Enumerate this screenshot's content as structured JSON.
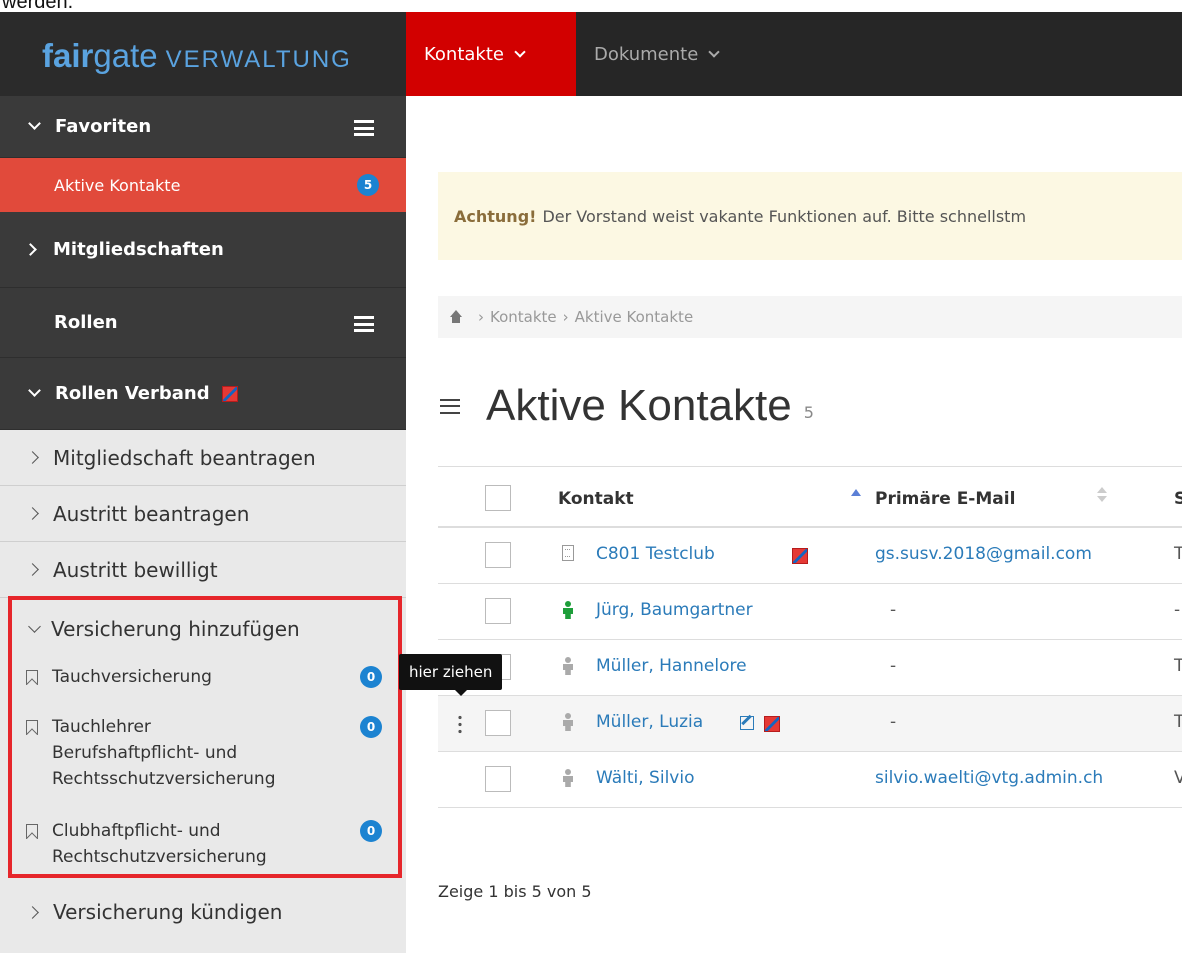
{
  "top_fragment": "werden.",
  "brand": {
    "fair": "fair",
    "gate": "gate",
    "suffix": "VERWALTUNG"
  },
  "nav": {
    "kontakte": "Kontakte",
    "dokumente": "Dokumente"
  },
  "sidebar": {
    "favoriten": "Favoriten",
    "aktive_kontakte": "Aktive Kontakte",
    "aktive_count": "5",
    "mitgliedschaften": "Mitgliedschaften",
    "rollen": "Rollen",
    "rollen_verband": "Rollen Verband",
    "items": [
      "Mitgliedschaft beantragen",
      "Austritt beantragen",
      "Austritt bewilligt"
    ],
    "versicherung_group": "Versicherung hinzufügen",
    "versicherung_items": [
      {
        "line1": "Tauchversicherung",
        "line2": "",
        "line3": "",
        "count": "0"
      },
      {
        "line1": "Tauchlehrer",
        "line2": "Berufshaftpflicht- und",
        "line3": "Rechtsschutzversicherung",
        "count": "0"
      },
      {
        "line1": "Clubhaftpflicht- und",
        "line2": "Rechtschutzversicherung",
        "line3": "",
        "count": "0"
      }
    ],
    "kuendigen": "Versicherung kündigen"
  },
  "alert": {
    "strong": "Achtung!",
    "text": "Der Vorstand weist vakante Funktionen auf. Bitte schnellstm"
  },
  "breadcrumb": {
    "kontakte": "Kontakte",
    "aktive": "Aktive Kontakte"
  },
  "page": {
    "title": "Aktive Kontakte",
    "count": "5"
  },
  "table": {
    "col_kontakt": "Kontakt",
    "col_email": "Primäre E-Mail",
    "col_cut": "S",
    "rows": [
      {
        "name": "C801 Testclub",
        "email": "gs.susv.2018@gmail.com",
        "cut": "T"
      },
      {
        "name": "Jürg, Baumgartner",
        "email": "-",
        "cut": "-"
      },
      {
        "name": "Müller, Hannelore",
        "email": "-",
        "cut": "T"
      },
      {
        "name": "Müller, Luzia",
        "email": "-",
        "cut": "T"
      },
      {
        "name": "Wälti, Silvio",
        "email": "silvio.waelti@vtg.admin.ch",
        "cut": "V"
      }
    ]
  },
  "tooltip": "hier ziehen",
  "footer": "Zeige 1 bis 5 von 5",
  "colors": {
    "nav_active": "#d20000",
    "sidebar_active": "#e14a3b",
    "badge": "#1c83d1",
    "link": "#2b7bb9",
    "highlight_box": "#e6262b"
  }
}
